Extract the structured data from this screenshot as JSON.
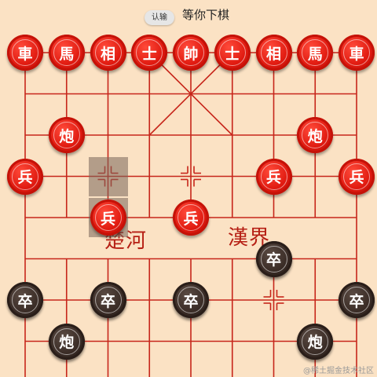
{
  "header": {
    "resign_label": "认输",
    "status_text": "等你下棋"
  },
  "river": {
    "left_text": "楚河",
    "right_text": "漢界"
  },
  "colors": {
    "board_line": "#c7261b",
    "background": "#fbe2c4",
    "red_piece": "#e01a10",
    "black_piece": "#3a2c26"
  },
  "selection": [
    {
      "file": 2,
      "rank": 3
    },
    {
      "file": 2,
      "rank": 4
    }
  ],
  "pieces": [
    {
      "label": "車",
      "side": "red",
      "file": 0,
      "rank": 0
    },
    {
      "label": "馬",
      "side": "red",
      "file": 1,
      "rank": 0
    },
    {
      "label": "相",
      "side": "red",
      "file": 2,
      "rank": 0
    },
    {
      "label": "士",
      "side": "red",
      "file": 3,
      "rank": 0
    },
    {
      "label": "帥",
      "side": "red",
      "file": 4,
      "rank": 0
    },
    {
      "label": "士",
      "side": "red",
      "file": 5,
      "rank": 0
    },
    {
      "label": "相",
      "side": "red",
      "file": 6,
      "rank": 0
    },
    {
      "label": "馬",
      "side": "red",
      "file": 7,
      "rank": 0
    },
    {
      "label": "車",
      "side": "red",
      "file": 8,
      "rank": 0
    },
    {
      "label": "炮",
      "side": "red",
      "file": 1,
      "rank": 2
    },
    {
      "label": "炮",
      "side": "red",
      "file": 7,
      "rank": 2
    },
    {
      "label": "兵",
      "side": "red",
      "file": 0,
      "rank": 3
    },
    {
      "label": "兵",
      "side": "red",
      "file": 6,
      "rank": 3
    },
    {
      "label": "兵",
      "side": "red",
      "file": 8,
      "rank": 3
    },
    {
      "label": "兵",
      "side": "red",
      "file": 2,
      "rank": 4
    },
    {
      "label": "兵",
      "side": "red",
      "file": 4,
      "rank": 4
    },
    {
      "label": "卒",
      "side": "black",
      "file": 6,
      "rank": 5
    },
    {
      "label": "卒",
      "side": "black",
      "file": 0,
      "rank": 6
    },
    {
      "label": "卒",
      "side": "black",
      "file": 2,
      "rank": 6
    },
    {
      "label": "卒",
      "side": "black",
      "file": 4,
      "rank": 6
    },
    {
      "label": "卒",
      "side": "black",
      "file": 8,
      "rank": 6
    },
    {
      "label": "炮",
      "side": "black",
      "file": 1,
      "rank": 7
    },
    {
      "label": "炮",
      "side": "black",
      "file": 7,
      "rank": 7
    }
  ],
  "watermark": "@稀土掘金技术社区"
}
